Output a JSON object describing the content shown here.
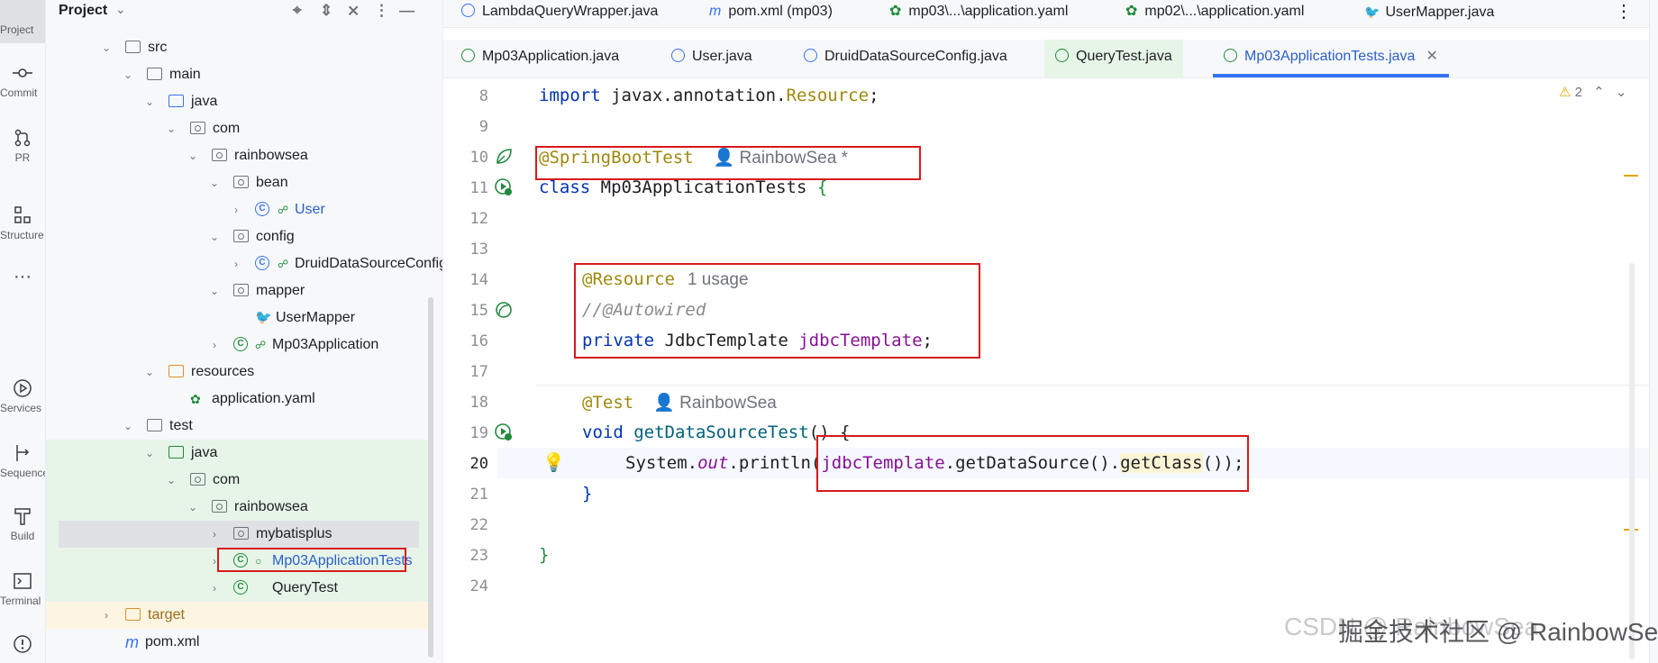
{
  "activity_bar": {
    "items": [
      {
        "label": "Project",
        "icon": "folder-icon"
      },
      {
        "label": "Commit",
        "icon": "commit-icon"
      },
      {
        "label": "PR",
        "icon": "pull-request-icon"
      },
      {
        "label": "Structure",
        "icon": "structure-icon"
      },
      {
        "label": "···",
        "icon": "more-icon"
      },
      {
        "label": "Services",
        "icon": "services-icon"
      },
      {
        "label": "Sequence",
        "icon": "sequence-icon"
      },
      {
        "label": "Build",
        "icon": "build-icon"
      },
      {
        "label": "Terminal",
        "icon": "terminal-icon"
      },
      {
        "label": "",
        "icon": "problems-icon"
      }
    ]
  },
  "project_panel": {
    "title": "Project",
    "tree": [
      {
        "label": "src"
      },
      {
        "label": "main"
      },
      {
        "label": "java"
      },
      {
        "label": "com"
      },
      {
        "label": "rainbowsea"
      },
      {
        "label": "bean"
      },
      {
        "label": "User"
      },
      {
        "label": "config"
      },
      {
        "label": "DruidDataSourceConfig"
      },
      {
        "label": "mapper"
      },
      {
        "label": "UserMapper"
      },
      {
        "label": "Mp03Application"
      },
      {
        "label": "resources"
      },
      {
        "label": "application.yaml"
      },
      {
        "label": "test"
      },
      {
        "label": "java"
      },
      {
        "label": "com"
      },
      {
        "label": "rainbowsea"
      },
      {
        "label": "mybatisplus"
      },
      {
        "label": "Mp03ApplicationTests"
      },
      {
        "label": "QueryTest"
      },
      {
        "label": "target"
      },
      {
        "label": "pom.xml"
      }
    ]
  },
  "tabs_row1": [
    {
      "label": "LambdaQueryWrapper.java"
    },
    {
      "label": "pom.xml (mp03)"
    },
    {
      "label": "mp03\\...\\application.yaml"
    },
    {
      "label": "mp02\\...\\application.yaml"
    },
    {
      "label": "UserMapper.java"
    }
  ],
  "tabs_row2": [
    {
      "label": "Mp03Application.java"
    },
    {
      "label": "User.java"
    },
    {
      "label": "DruidDataSourceConfig.java"
    },
    {
      "label": "QueryTest.java"
    },
    {
      "label": "Mp03ApplicationTests.java",
      "active": true
    }
  ],
  "editor": {
    "warnings_count": "2",
    "line_numbers": [
      "8",
      "9",
      "10",
      "11",
      "12",
      "13",
      "14",
      "15",
      "16",
      "17",
      "18",
      "19",
      "20",
      "21",
      "22",
      "23",
      "24"
    ],
    "lines": {
      "l8_kw": "import",
      "l8_pkg": " javax.annotation.",
      "l8_cls": "Resource",
      "l8_end": ";",
      "l10_ann": "@SpringBootTest",
      "l10_author": "RainbowSea *",
      "l11_kw": "class",
      "l11_name": " Mp03ApplicationTests ",
      "l11_brace": "{",
      "l14_ann": "@Resource",
      "l14_usage": "1 usage",
      "l15_cmt": "//@Autowired",
      "l16_kw": "private",
      "l16_type": " JdbcTemplate ",
      "l16_field": "jdbcTemplate",
      "l16_end": ";",
      "l18_ann": "@Test",
      "l18_author": "RainbowSea",
      "l19_kw": "void",
      "l19_name": " getDataSourceTest",
      "l19_rest": "() {",
      "l20_sys": "System.",
      "l20_out": "out",
      "l20_println": ".println(",
      "l20_field": "jdbcTemplate",
      "l20_call": ".getDataSource().",
      "l20_getclass": "getClass",
      "l20_end": "());",
      "l21_brace": "}",
      "l23_brace": "}"
    }
  },
  "watermark": "CSDN @ RainbowSea",
  "watermark_overlay": "掘金技术社区 @ RainbowSea"
}
